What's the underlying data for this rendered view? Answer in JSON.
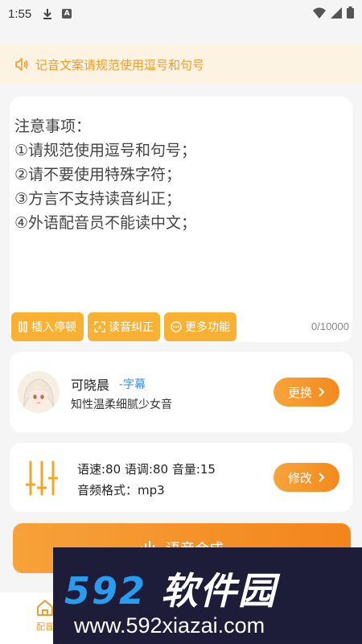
{
  "status_bar": {
    "time": "1:55",
    "a_badge": "A"
  },
  "notice": {
    "text": "记音文案请规范使用逗号和句号",
    "color": "#f39c2a"
  },
  "editor": {
    "lines": [
      "注意事项：",
      "①请规范使用逗号和句号；",
      "②请不要使用特殊字符；",
      "③方言不支持读音纠正；",
      "④外语配音员不能读中文；"
    ],
    "tools": [
      {
        "label": "插入停顿",
        "icon": "pause-icon"
      },
      {
        "label": "读音纠正",
        "icon": "correct-icon"
      },
      {
        "label": "更多功能",
        "icon": "more-icon"
      }
    ],
    "counter": "0/10000"
  },
  "voice": {
    "name": "可晓晨",
    "tag": "-字幕",
    "desc": "知性温柔细腻少女音",
    "button": "更换"
  },
  "params": {
    "line1": "语速:80 语调:80 音量:15",
    "line2": "音频格式：mp3",
    "button": "修改"
  },
  "synth_button": {
    "label": "语音合成"
  },
  "bottom_nav": {
    "items": [
      {
        "label": "配音",
        "icon": "home-icon"
      }
    ]
  },
  "watermark": {
    "brand_num": "592",
    "brand_cn": "软件园",
    "url": "www.592xiazai.com"
  },
  "colors": {
    "accent": "#f39c2a",
    "tool": "#f8b133",
    "link": "#3a8ee6"
  }
}
